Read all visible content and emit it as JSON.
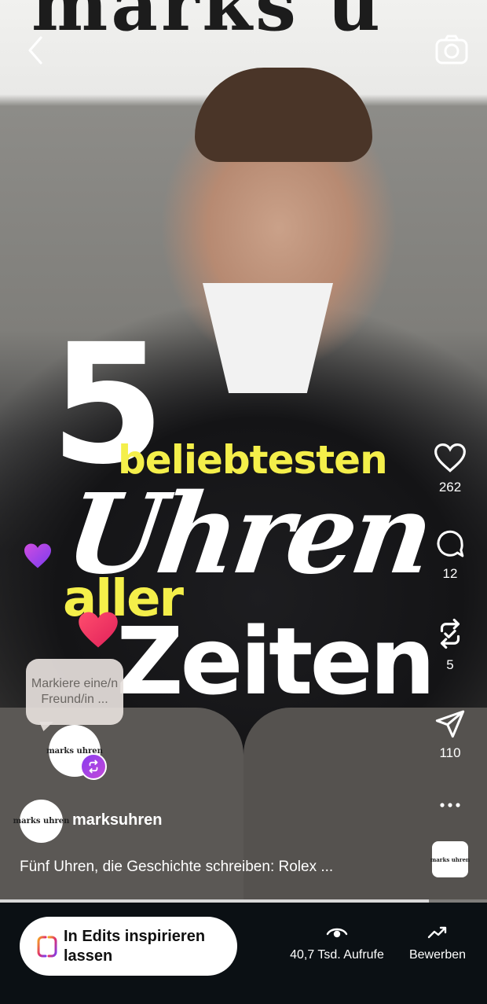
{
  "overlay": {
    "line1_number": "5",
    "line1_word": "beliebtesten",
    "line2": "Uhren",
    "line3": "aller",
    "line4": "Zeiten"
  },
  "background_sign": "marks u",
  "actions": {
    "likes": "262",
    "comments": "12",
    "reposts": "5",
    "shares": "110"
  },
  "mention_prompt": "Markiere eine/n Freund/in ...",
  "brand_logo_text": "marks uhren",
  "author": {
    "username": "marksuhren"
  },
  "caption": "Fünf Uhren, die Geschichte schreiben: Rolex ...",
  "video_progress": 0.88,
  "bottom_bar": {
    "edits_button": "In Edits inspirieren lassen",
    "views": "40,7 Tsd. Aufrufe",
    "promote": "Bewerben"
  },
  "colors": {
    "highlight_yellow": "#f4ef4a",
    "bottom_bar_bg": "#0b1014",
    "remix_badge": "#8a3cf0"
  },
  "icons": [
    "back-chevron-icon",
    "camera-icon",
    "heart-icon",
    "comment-icon",
    "repost-icon",
    "send-icon",
    "more-icon",
    "remix-icon",
    "edits-icon",
    "eye-icon",
    "trending-up-icon"
  ]
}
